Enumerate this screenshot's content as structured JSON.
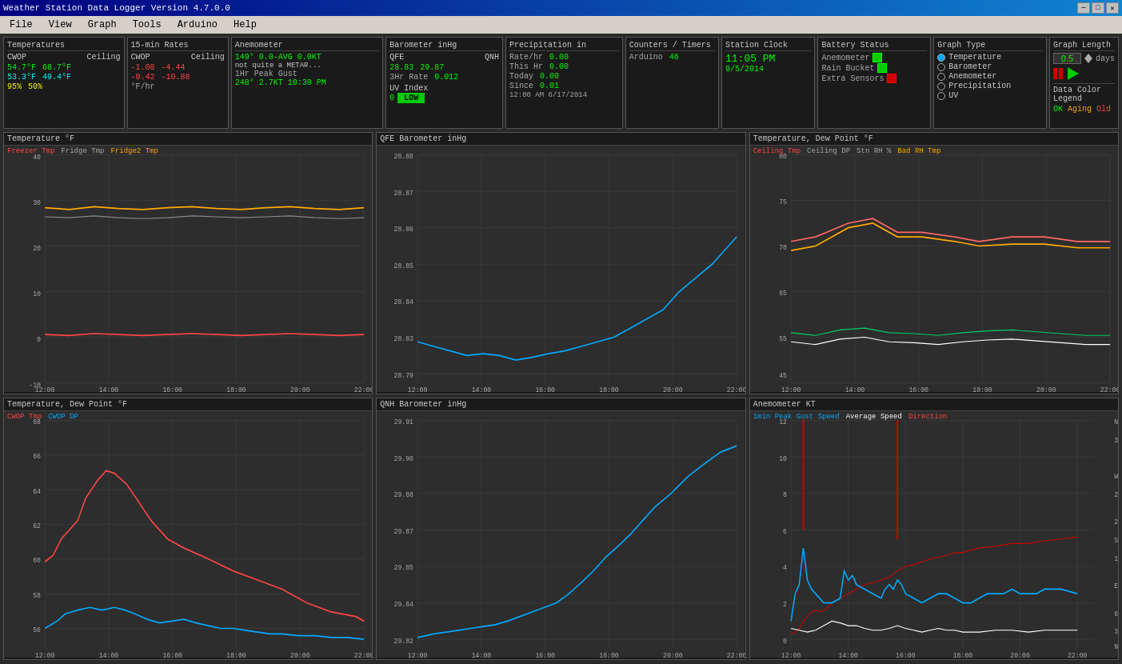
{
  "window": {
    "title": "Weather Station Data Logger Version 4.7.0.0",
    "min": "─",
    "max": "□",
    "close": "✕"
  },
  "menu": {
    "items": [
      "File",
      "View",
      "Graph",
      "Tools",
      "Arduino",
      "Help"
    ]
  },
  "temperatures": {
    "title": "Temperatures",
    "col1": "CWOP",
    "col2": "Ceiling",
    "row1_c1": "54.7°F",
    "row1_c2": "68.7°F",
    "row2_c1": "53.3°F",
    "row2_c2": "49.4°F",
    "row3_c1": "95%",
    "row3_c2": "50%"
  },
  "rates": {
    "title": "15-min Rates",
    "col1": "CWOP",
    "col2": "Ceiling",
    "row1_c1": "-1.08",
    "row1_c2": "-4.44",
    "row2_c1": "-0.42",
    "row2_c2": "-10.88",
    "unit": "°F/hr"
  },
  "anemometer": {
    "title": "Anemometer",
    "line1": "149° 0.0-AVG 0.0KT",
    "line2": "not quite a METAR...",
    "line3": "1Hr Peak Gust",
    "line4": "248° 2.7KT 10:30 PM"
  },
  "barometer": {
    "title": "Barometer inHg",
    "col1": "QFE",
    "col2": "QNH",
    "qfe": "28.83",
    "qnh": "29.87",
    "rate_label": "3Hr Rate",
    "rate": "0.012",
    "uv_label": "UV Index",
    "uv_val": "0",
    "uv_status": "LOW"
  },
  "precipitation": {
    "title": "Precipitation in",
    "rate_label": "Rate/hr",
    "rate_val": "0.00",
    "this_hr_label": "This Hr",
    "this_hr_val": "0.00",
    "today_label": "Today",
    "today_val": "0.00",
    "since_label": "Since",
    "since_val": "0.01",
    "since_date": "12:00 AM 6/17/2014"
  },
  "counters": {
    "title": "Counters / Timers",
    "arduino_label": "Arduino",
    "arduino_val": "46"
  },
  "clock": {
    "title": "Station Clock",
    "time": "11:05 PM",
    "date": "9/5/2014"
  },
  "battery": {
    "title": "Battery Status",
    "anem_label": "Anemometer",
    "rain_label": "Rain Bucket",
    "extra_label": "Extra Sensors"
  },
  "graphtype": {
    "title": "Graph Type",
    "options": [
      "Temperature",
      "Barometer",
      "Anemometer",
      "Precipitation",
      "UV"
    ],
    "selected": 0
  },
  "graphlen": {
    "title": "Graph Length",
    "value": "0.5",
    "unit": "days",
    "legend_title": "Data Color Legend",
    "ok": "OK",
    "aging": "Aging",
    "old": "Old"
  },
  "graphs": {
    "top_left": {
      "title": "Temperature  °F",
      "legends": [
        {
          "label": "Freezer Tmp",
          "color": "#ff4444"
        },
        {
          "label": "Fridge Tmp",
          "color": "#aaaaaa"
        },
        {
          "label": "Fridge2 Tmp",
          "color": "#ffaa00"
        }
      ],
      "y_min": -10,
      "y_max": 40,
      "x_labels": [
        "12:00",
        "14:00",
        "16:00",
        "18:00",
        "20:00",
        "22:00"
      ]
    },
    "top_center": {
      "title": "QFE Barometer  inHg",
      "legends": [],
      "y_min": 28.79,
      "y_max": 28.88,
      "x_labels": [
        "12:00",
        "14:00",
        "16:00",
        "18:00",
        "20:00",
        "22:00"
      ]
    },
    "top_right": {
      "title": "Temperature, Dew Point  °F",
      "legends": [
        {
          "label": "Ceiling Tmp",
          "color": "#ff4444"
        },
        {
          "label": "Ceiling DP",
          "color": "#aaaaaa"
        },
        {
          "label": "Bad RH Tmp",
          "color": "#ffaa00"
        }
      ],
      "y_min": 45,
      "y_max": 80,
      "x_labels": [
        "12:00",
        "14:00",
        "16:00",
        "18:00",
        "20:00",
        "22:00"
      ]
    },
    "bottom_left": {
      "title": "Temperature, Dew Point  °F",
      "legends": [
        {
          "label": "CWOP Tmp",
          "color": "#ff4444"
        },
        {
          "label": "CWOP DP",
          "color": "#00aaff"
        }
      ],
      "y_min": 52,
      "y_max": 68,
      "x_labels": [
        "12:00",
        "14:00",
        "16:00",
        "18:00",
        "20:00",
        "22:00"
      ]
    },
    "bottom_center": {
      "title": "QNH Barometer  inHg",
      "legends": [],
      "y_min": 29.82,
      "y_max": 29.91,
      "x_labels": [
        "12:00",
        "14:00",
        "16:00",
        "18:00",
        "20:00",
        "22:00"
      ]
    },
    "bottom_right": {
      "title": "Anemometer  KT",
      "legends": [
        {
          "label": "1min Peak Gust Speed",
          "color": "#00aaff"
        },
        {
          "label": "Average Speed",
          "color": "#ffffff"
        },
        {
          "label": "Direction",
          "color": "#ff4444"
        }
      ],
      "y_min": 0,
      "y_max": 12,
      "x_labels": [
        "12:00",
        "14:00",
        "16:00",
        "18:00",
        "20:00",
        "22:00"
      ]
    }
  }
}
